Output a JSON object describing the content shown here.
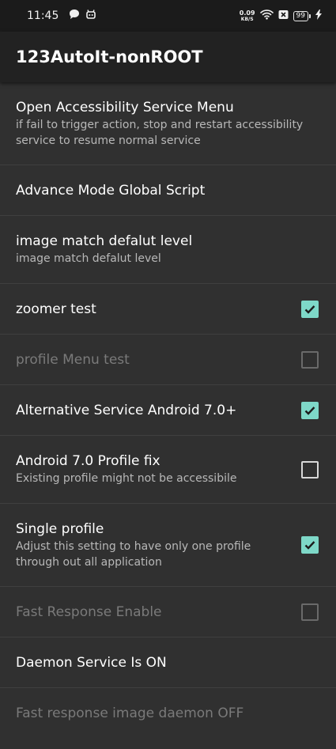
{
  "status_bar": {
    "time": "11:45",
    "net_speed_value": "0.09",
    "net_speed_unit": "KB/S",
    "battery": "99"
  },
  "app_bar": {
    "title": "123AutoIt-nonROOT"
  },
  "settings": [
    {
      "title": "Open Accessibility Service Menu",
      "subtitle": "if fail to trigger action, stop and restart accessibility service to resume normal service",
      "enabled": true
    },
    {
      "title": "Advance Mode Global Script",
      "enabled": true
    },
    {
      "title": "image match defalut level",
      "subtitle": "image match defalut level",
      "enabled": true
    },
    {
      "title": "zoomer test",
      "checked": true,
      "enabled": true
    },
    {
      "title": "profile Menu test",
      "checked": false,
      "enabled": false
    },
    {
      "title": "Alternative Service Android 7.0+",
      "checked": true,
      "enabled": true
    },
    {
      "title": "Android 7.0 Profile fix",
      "subtitle": "Existing profile might not be accessibile",
      "checked": false,
      "enabled": true
    },
    {
      "title": "Single profile",
      "subtitle": "Adjust this setting to have only one profile through out all application",
      "checked": true,
      "enabled": true
    },
    {
      "title": "Fast Response Enable",
      "checked": false,
      "enabled": false
    },
    {
      "title": "Daemon Service Is ON",
      "enabled": true
    },
    {
      "title": "Fast response image daemon OFF",
      "enabled": false
    }
  ],
  "colors": {
    "checkbox_checked": "#7ed8c8",
    "background": "#303030",
    "app_bar": "#222222"
  }
}
